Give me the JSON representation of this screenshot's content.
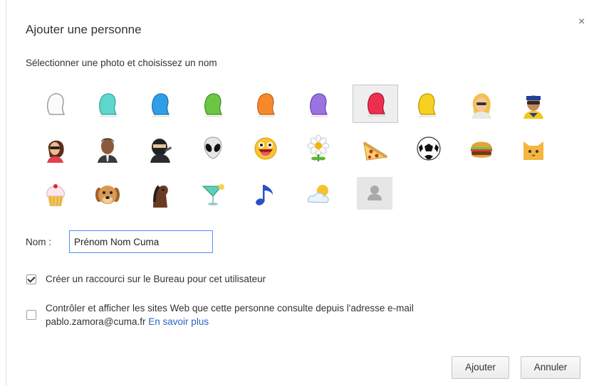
{
  "dialog": {
    "title": "Ajouter une personne",
    "close_glyph": "×",
    "subtitle": "Sélectionner une photo et choisissez un nom"
  },
  "avatars": [
    {
      "name": "generic-white",
      "selected": false
    },
    {
      "name": "generic-aqua",
      "selected": false
    },
    {
      "name": "generic-blue",
      "selected": false
    },
    {
      "name": "generic-green",
      "selected": false
    },
    {
      "name": "generic-orange",
      "selected": false
    },
    {
      "name": "generic-purple",
      "selected": false
    },
    {
      "name": "generic-red",
      "selected": true
    },
    {
      "name": "generic-yellow",
      "selected": false
    },
    {
      "name": "businesswoman",
      "selected": false
    },
    {
      "name": "ninja-hero",
      "selected": false
    },
    {
      "name": "woman-sunglasses",
      "selected": false
    },
    {
      "name": "businessman",
      "selected": false
    },
    {
      "name": "ninja",
      "selected": false
    },
    {
      "name": "alien",
      "selected": false
    },
    {
      "name": "awesome-smiley",
      "selected": false
    },
    {
      "name": "flower",
      "selected": false
    },
    {
      "name": "pizza",
      "selected": false
    },
    {
      "name": "soccer-ball",
      "selected": false
    },
    {
      "name": "burger",
      "selected": false
    },
    {
      "name": "cat",
      "selected": false
    },
    {
      "name": "cupcake",
      "selected": false
    },
    {
      "name": "dog",
      "selected": false
    },
    {
      "name": "horse",
      "selected": false
    },
    {
      "name": "cocktail",
      "selected": false
    },
    {
      "name": "music-note",
      "selected": false
    },
    {
      "name": "sun-cloud",
      "selected": false
    },
    {
      "name": "profile-placeholder",
      "selected": false
    }
  ],
  "form": {
    "name_label": "Nom :",
    "name_value": "Prénom Nom Cuma"
  },
  "options": {
    "shortcut_checked": true,
    "shortcut_label": "Créer un raccourci sur le Bureau pour cet utilisateur",
    "supervise_checked": false,
    "supervise_label_line1": "Contrôler et afficher les sites Web que cette personne consulte depuis l'adresse e-mail",
    "supervise_email": "pablo.zamora@cuma.fr",
    "supervise_link": "En savoir plus"
  },
  "buttons": {
    "add_label": "Ajouter",
    "cancel_label": "Annuler"
  },
  "colors": {
    "link": "#2a64c5",
    "input_focus_border": "#4d90fe"
  }
}
